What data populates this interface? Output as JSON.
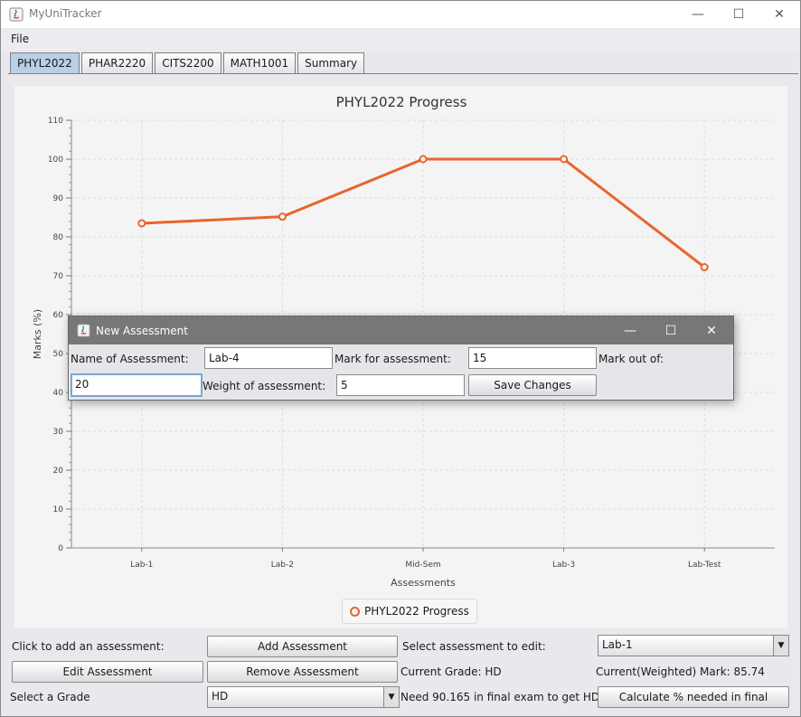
{
  "window": {
    "title": "MyUniTracker",
    "minimize": "—",
    "maximize": "☐",
    "close": "✕"
  },
  "menu": {
    "file": "File"
  },
  "tabs": [
    {
      "label": "PHYL2022",
      "active": true
    },
    {
      "label": "PHAR2220"
    },
    {
      "label": "CITS2200"
    },
    {
      "label": "MATH1001"
    },
    {
      "label": "Summary"
    }
  ],
  "chart_data": {
    "type": "line",
    "title": "PHYL2022 Progress",
    "xlabel": "Assessments",
    "ylabel": "Marks (%)",
    "categories": [
      "Lab-1",
      "Lab-2",
      "Mid-Sem",
      "Lab-3",
      "Lab-Test"
    ],
    "series": [
      {
        "name": "PHYL2022 Progress",
        "values": [
          83.5,
          85.2,
          100,
          100,
          72.2
        ],
        "color": "#e8642e"
      }
    ],
    "ylim": [
      0,
      110
    ],
    "yticks": [
      0,
      10,
      20,
      30,
      40,
      50,
      60,
      70,
      80,
      90,
      100,
      110
    ],
    "grid": true,
    "legend": "bottom-center"
  },
  "legend_label": "PHYL2022 Progress",
  "controls": {
    "add_label": "Click to add an assessment:",
    "add_button": "Add Assessment",
    "select_edit_label": "Select assessment to edit:",
    "select_edit_value": "Lab-1",
    "edit_button": "Edit Assessment",
    "remove_button": "Remove Assessment",
    "current_grade": "Current Grade: HD",
    "weighted_mark": "Current(Weighted) Mark: 85.74",
    "select_grade_label": "Select a Grade",
    "grade_value": "HD",
    "need_text": "Need 90.165 in final exam to get HD.",
    "calc_button": "Calculate % needed in final"
  },
  "dialog": {
    "title": "New Assessment",
    "name_label": "Name of Assessment:",
    "name_value": "Lab-4",
    "mark_label": "Mark for assessment:",
    "mark_value": "15",
    "out_of_label": "Mark out of:",
    "out_of_value": "20",
    "weight_label": "Weight of assessment:",
    "weight_value": "5",
    "save_button": "Save Changes"
  }
}
